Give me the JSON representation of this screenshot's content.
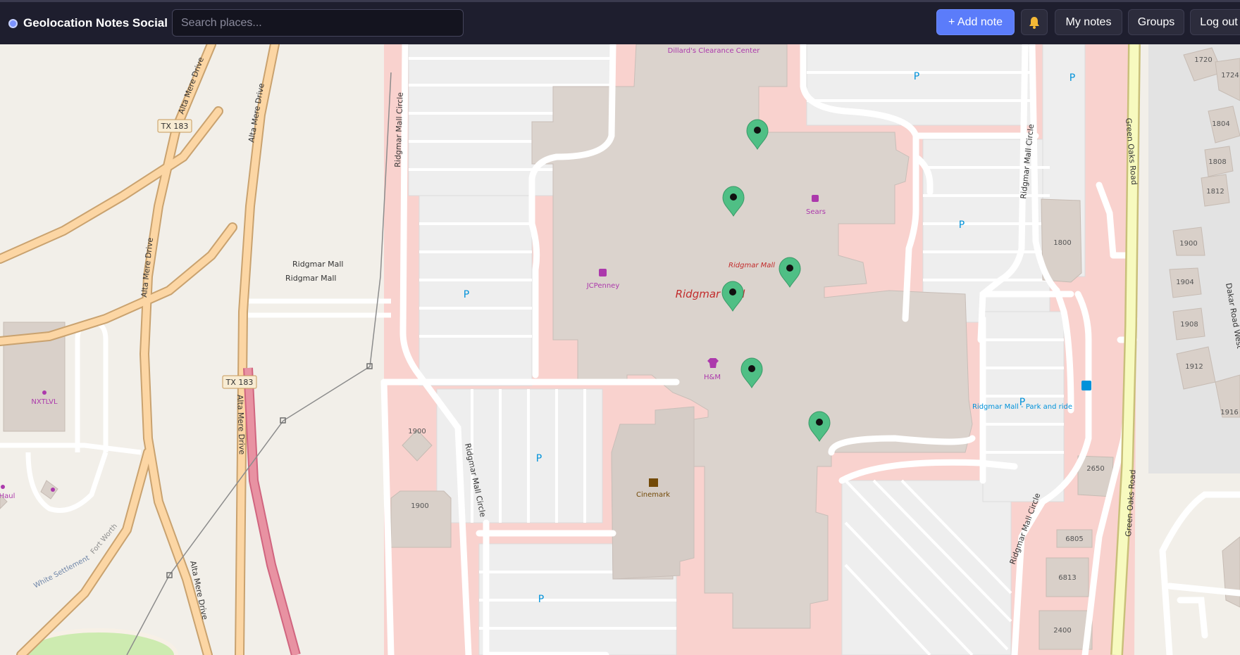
{
  "app": {
    "title": "Geolocation Notes Social"
  },
  "search": {
    "placeholder": "Search places..."
  },
  "nav": {
    "add_note": "+ Add note",
    "notifications_icon": "bell-icon",
    "my_notes": "My notes",
    "groups": "Groups",
    "logout": "Log out"
  },
  "map": {
    "roads": {
      "alta_mere_1": "Alta Mere Drive",
      "alta_mere_2": "Alta Mere Drive",
      "alta_mere_3": "Alta Mere Drive",
      "alta_mere_4": "Alta Mere Drive",
      "alta_mere_5": "Alta Mere Drive",
      "tx183_1": "TX 183",
      "tx183_2": "TX 183",
      "ridgmar_mall_w": "Ridgmar Mall",
      "ridgmar_mall_e": "Ridgmar Mall",
      "ridgmar_mall_circle_1": "Ridgmar Mall Circle",
      "ridgmar_mall_circle_2": "Ridgmar Mall Circle",
      "ridgmar_mall_circle_3": "Ridgmar Mall Circle",
      "ridgmar_mall_circle_4": "Ridgmar Mall Circle",
      "green_oaks_1": "Green Oaks Road",
      "green_oaks_2": "Green Oaks Road",
      "dakar_road": "Dakar Road West",
      "white_settlement": "White Settlement",
      "fort_worth": "Fort Worth"
    },
    "pois": {
      "dillards": "Dillard's Clearance Center",
      "sears": "Sears",
      "jcpenney": "JCPenney",
      "ridgmar_mall_small": "Ridgmar Mall",
      "ridgmar_mall_big": "Ridgmar Mall",
      "hm": "H&M",
      "cinemark": "Cinemark",
      "nxtlvl": "NXTLVL",
      "uhaul": "Haul",
      "park_and_ride": "Ridgmar Mall - Park and ride"
    },
    "parking_symbol": "P",
    "house_numbers": [
      "1720",
      "1724",
      "1804",
      "1808",
      "1812",
      "1800",
      "1900",
      "1904",
      "1908",
      "1912",
      "1916",
      "2650",
      "6805",
      "6813",
      "2400",
      "1900",
      "1900"
    ],
    "markers_count": 6,
    "colors": {
      "marker": "#4fbf85",
      "mall_area": "#f9d2ce",
      "building": "#dbd3cd",
      "parking": "#eeeeee",
      "motorway": "#fcd6a4",
      "trunk": "#e892a2",
      "poi": "#ac39ac",
      "accent": "#5b7cfa"
    }
  }
}
